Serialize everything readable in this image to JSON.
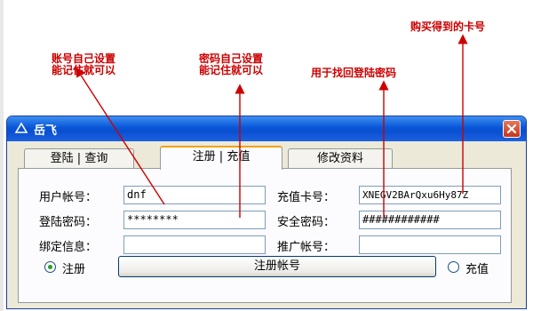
{
  "annotations": {
    "account_note_line1": "账号自己设置",
    "account_note_line2": "能记住就可以",
    "password_note_line1": "密码自己设置",
    "password_note_line2": "能记住就可以",
    "safety_note": "用于找回登陆密码",
    "card_note": "购买得到的卡号"
  },
  "window": {
    "title": "岳飞"
  },
  "tabs": [
    {
      "label": "登陆 | 查询"
    },
    {
      "label": "注册 | 充值"
    },
    {
      "label": "修改资料"
    }
  ],
  "form": {
    "username_label": "用户帐号：",
    "username_value": "dnf",
    "password_label": "登陆密码：",
    "password_value": "********",
    "bind_label": "绑定信息：",
    "bind_value": "",
    "card_label": "充值卡号：",
    "card_value": "XNEGV2BArQxu6Hy87Z",
    "safety_label": "安全密码：",
    "safety_value": "############",
    "promo_label": "推广帐号：",
    "promo_value": ""
  },
  "actions": {
    "register_radio_label": "注册",
    "register_button_label": "注册帐号",
    "recharge_radio_label": "充值",
    "selected_mode": "注册"
  },
  "colors": {
    "annotation_text": "#cc0000",
    "arrow": "#cc0000",
    "title_bar": "#0856d8",
    "close_button": "#c6341a",
    "dialog_background": "#ece9d8"
  },
  "icons": {
    "title": "app-triangle-icon",
    "close": "close-x-icon"
  }
}
